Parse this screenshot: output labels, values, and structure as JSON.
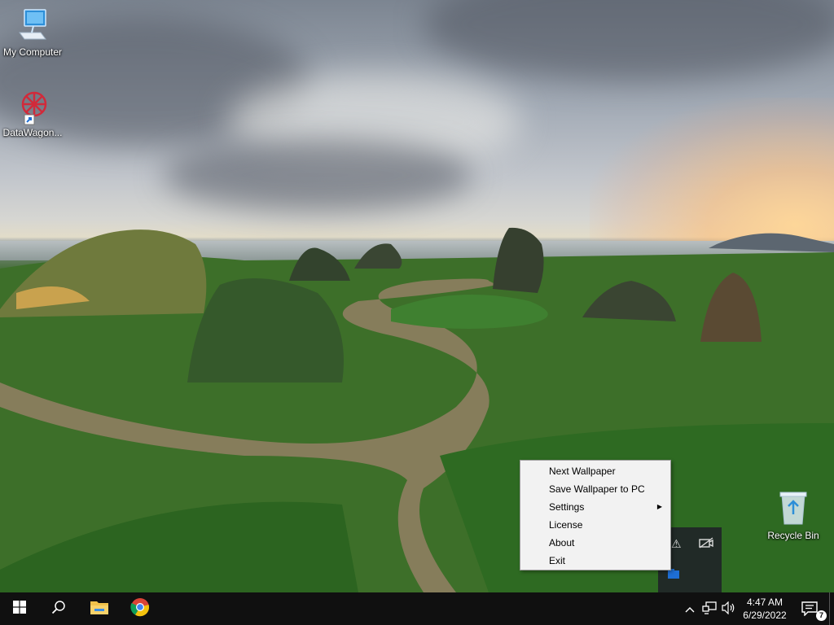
{
  "desktop": {
    "icons": [
      {
        "label": "My Computer"
      },
      {
        "label": "DataWagon..."
      },
      {
        "label": "Recycle Bin"
      }
    ]
  },
  "context_menu": {
    "items": [
      {
        "label": "Next Wallpaper",
        "has_submenu": false
      },
      {
        "label": "Save Wallpaper to PC",
        "has_submenu": false
      },
      {
        "label": "Settings",
        "has_submenu": true
      },
      {
        "label": "License",
        "has_submenu": false
      },
      {
        "label": "About",
        "has_submenu": false
      },
      {
        "label": "Exit",
        "has_submenu": false
      }
    ]
  },
  "taskbar": {
    "pinned": [
      "start-icon",
      "search-icon",
      "file-explorer-icon",
      "chrome-icon"
    ],
    "clock": {
      "time": "4:47 AM",
      "date": "6/29/2022"
    },
    "notification_count": "7",
    "colors": {
      "bar": "#101010",
      "accent": "#7aa7d8"
    }
  }
}
